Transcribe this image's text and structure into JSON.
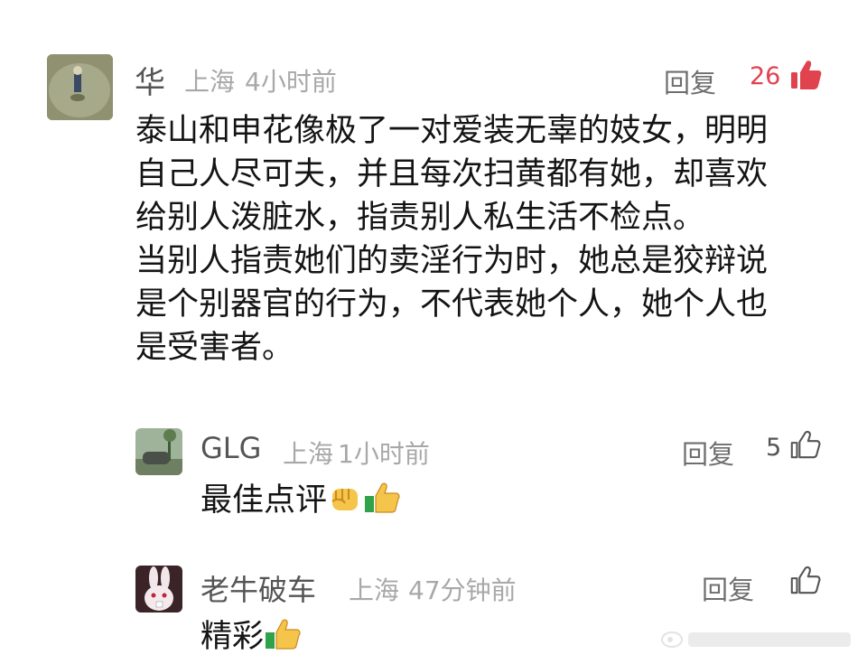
{
  "comment": {
    "author": "华",
    "location": "上海",
    "time": "4小时前",
    "reply_label": "回复",
    "likes": "26",
    "text_lines": [
      "泰山和申花像极了一对爱装无辜的妓女，明明",
      "自己人尽可夫，并且每次扫黄都有她，却喜欢",
      "给别人泼脏水，指责别人私生活不检点。",
      "当别人指责她们的卖淫行为时，她总是狡辩说",
      "是个别器官的行为，不代表她个人，她个人也",
      "是受害者。"
    ],
    "likes_color": "#e0434e"
  },
  "replies": [
    {
      "author": "GLG",
      "location": "上海",
      "time": "1小时前",
      "reply_label": "回复",
      "likes": "5",
      "text": "最佳点评",
      "emojis": [
        "fist-emoji",
        "thumbs-up-emoji"
      ]
    },
    {
      "author": "老牛破车",
      "location": "上海",
      "time": "47分钟前",
      "reply_label": "回复",
      "likes": "",
      "text": "精彩",
      "emojis": [
        "thumbs-up-emoji"
      ]
    }
  ],
  "icons": {
    "like_filled": "thumbs-up-filled-icon",
    "like_outline": "thumbs-up-outline-icon"
  }
}
